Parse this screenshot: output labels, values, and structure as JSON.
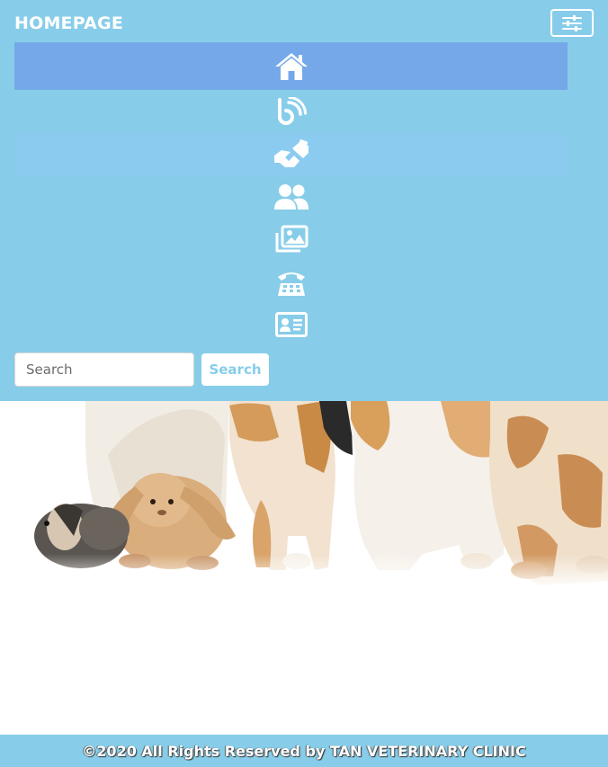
{
  "navbar": {
    "brand": "HOMEPAGE",
    "toggler_icon": "sliders-icon",
    "items": [
      {
        "name": "home",
        "icon": "home-icon",
        "active": true
      },
      {
        "name": "blog",
        "icon": "blog-icon"
      },
      {
        "name": "services",
        "icon": "handshake-icon"
      },
      {
        "name": "about",
        "icon": "users-icon"
      },
      {
        "name": "gallery",
        "icon": "images-icon"
      },
      {
        "name": "contact",
        "icon": "phone-icon"
      },
      {
        "name": "profile",
        "icon": "id-card-icon"
      }
    ]
  },
  "search": {
    "placeholder": "Search",
    "button_label": "Search"
  },
  "hero": {
    "image": "pets-banner"
  },
  "footer": {
    "text": "©2020 All Rights Reserved by TAN VETERINARY CLINIC"
  },
  "colors": {
    "navbar_bg": "#87cde9",
    "active_bg": "#74a8e9",
    "white": "#ffffff"
  }
}
